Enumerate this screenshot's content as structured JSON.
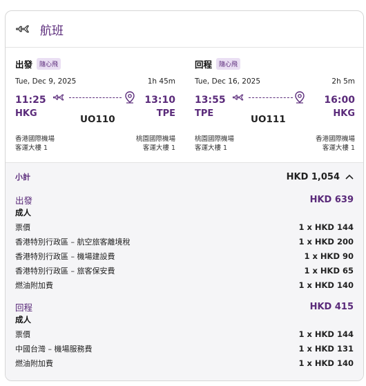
{
  "header": {
    "title": "航班",
    "icon": "plane-icon"
  },
  "outbound": {
    "direction": "出發",
    "badge": "隨心飛",
    "date": "Tue, Dec 9, 2025",
    "duration": "1h 45m",
    "depart_time": "11:25",
    "depart_code": "HKG",
    "arrive_time": "13:10",
    "arrive_code": "TPE",
    "flight_no": "UO110",
    "depart_airport": "香港國際機場",
    "depart_terminal": "客運大樓 1",
    "arrive_airport": "桃園國際機場",
    "arrive_terminal": "客運大樓 1"
  },
  "return": {
    "direction": "回程",
    "badge": "隨心飛",
    "date": "Tue, Dec 16, 2025",
    "duration": "2h 5m",
    "depart_time": "13:55",
    "depart_code": "TPE",
    "arrive_time": "16:00",
    "arrive_code": "HKG",
    "flight_no": "UO111",
    "depart_airport": "桃園國際機場",
    "depart_terminal": "客運大樓 1",
    "arrive_airport": "香港國際機場",
    "arrive_terminal": "客運大樓 1"
  },
  "summary": {
    "subtotal_label": "小計",
    "subtotal_value": "HKD 1,054",
    "outbound": {
      "label": "出發",
      "total": "HKD 639",
      "pax": "成人",
      "items": [
        {
          "label": "票價",
          "value": "1 x HKD 144"
        },
        {
          "label": "香港特別行政區 – 航空旅客離境稅",
          "value": "1 x HKD 200"
        },
        {
          "label": "香港特別行政區 – 機場建設費",
          "value": "1 x HKD 90"
        },
        {
          "label": "香港特別行政區 – 旅客保安費",
          "value": "1 x HKD 65"
        },
        {
          "label": "燃油附加費",
          "value": "1 x HKD 140"
        }
      ]
    },
    "return": {
      "label": "回程",
      "total": "HKD 415",
      "pax": "成人",
      "items": [
        {
          "label": "票價",
          "value": "1 x HKD 144"
        },
        {
          "label": "中國台灣 – 機場服務費",
          "value": "1 x HKD 131"
        },
        {
          "label": "燃油附加費",
          "value": "1 x HKD 140"
        }
      ]
    }
  },
  "colors": {
    "accent": "#5a2a7a",
    "badge_bg": "#eadff3",
    "panel_bg": "#f5f5f7"
  }
}
